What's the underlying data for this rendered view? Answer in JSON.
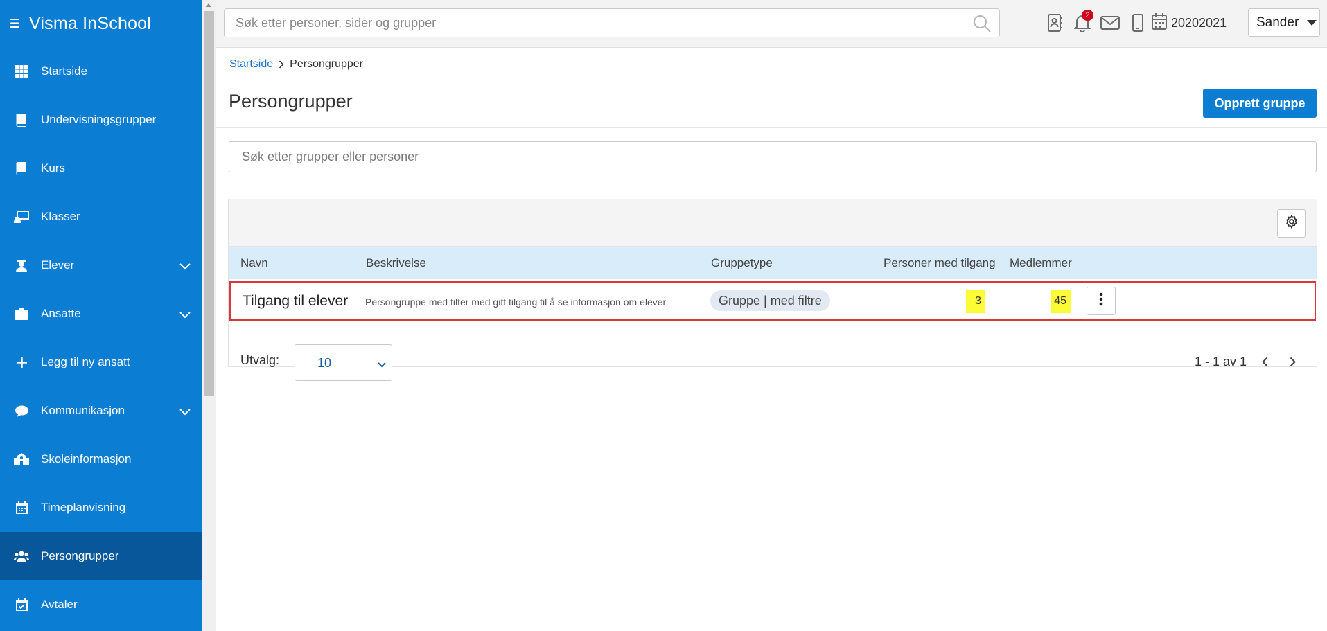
{
  "app": {
    "title": "Visma InSchool",
    "menu_icon": "hamburger-icon"
  },
  "sidebar": {
    "items": [
      {
        "label": "Startside",
        "icon": "grid-icon"
      },
      {
        "label": "Undervisningsgrupper",
        "icon": "book-icon"
      },
      {
        "label": "Kurs",
        "icon": "book-icon"
      },
      {
        "label": "Klasser",
        "icon": "classroom-icon"
      },
      {
        "label": "Elever",
        "icon": "student-icon",
        "expandable": true
      },
      {
        "label": "Ansatte",
        "icon": "briefcase-icon",
        "expandable": true
      },
      {
        "label": "Legg til ny ansatt",
        "icon": "plus-icon"
      },
      {
        "label": "Kommunikasjon",
        "icon": "chat-icon",
        "expandable": true
      },
      {
        "label": "Skoleinformasjon",
        "icon": "school-icon"
      },
      {
        "label": "Timeplanvisning",
        "icon": "calendar-icon"
      },
      {
        "label": "Persongrupper",
        "icon": "people-icon",
        "active": true
      },
      {
        "label": "Avtaler",
        "icon": "calendar-check-icon"
      }
    ]
  },
  "topbar": {
    "search_placeholder": "Søk etter personer, sider og grupper",
    "notification_count": "2",
    "school_year": "20202021",
    "user_name": "Sander"
  },
  "breadcrumb": {
    "home": "Startside",
    "current": "Persongrupper"
  },
  "page": {
    "title": "Persongrupper",
    "create_button": "Opprett gruppe",
    "group_search_placeholder": "Søk etter grupper eller personer"
  },
  "table": {
    "columns": {
      "name": "Navn",
      "description": "Beskrivelse",
      "group_type": "Gruppetype",
      "persons_with_access": "Personer med tilgang",
      "members": "Medlemmer"
    },
    "rows": [
      {
        "name": "Tilgang til elever",
        "description": "Persongruppe med filter med gitt tilgang til å se informasjon om elever",
        "group_type": "Gruppe | med filtre",
        "persons_with_access": "3",
        "members": "45"
      }
    ]
  },
  "pagination": {
    "utvalg_label": "Utvalg:",
    "page_size": "10",
    "range_text": "1 - 1 av 1"
  },
  "colors": {
    "sidebar_bg": "#0b7dd3",
    "sidebar_active": "#07579a",
    "primary_button": "#0b7dd3",
    "table_header_bg": "#d8ecfa",
    "highlight_yellow": "#fbfb36",
    "row_outline": "#d9363e",
    "badge_red": "#d0021b"
  }
}
